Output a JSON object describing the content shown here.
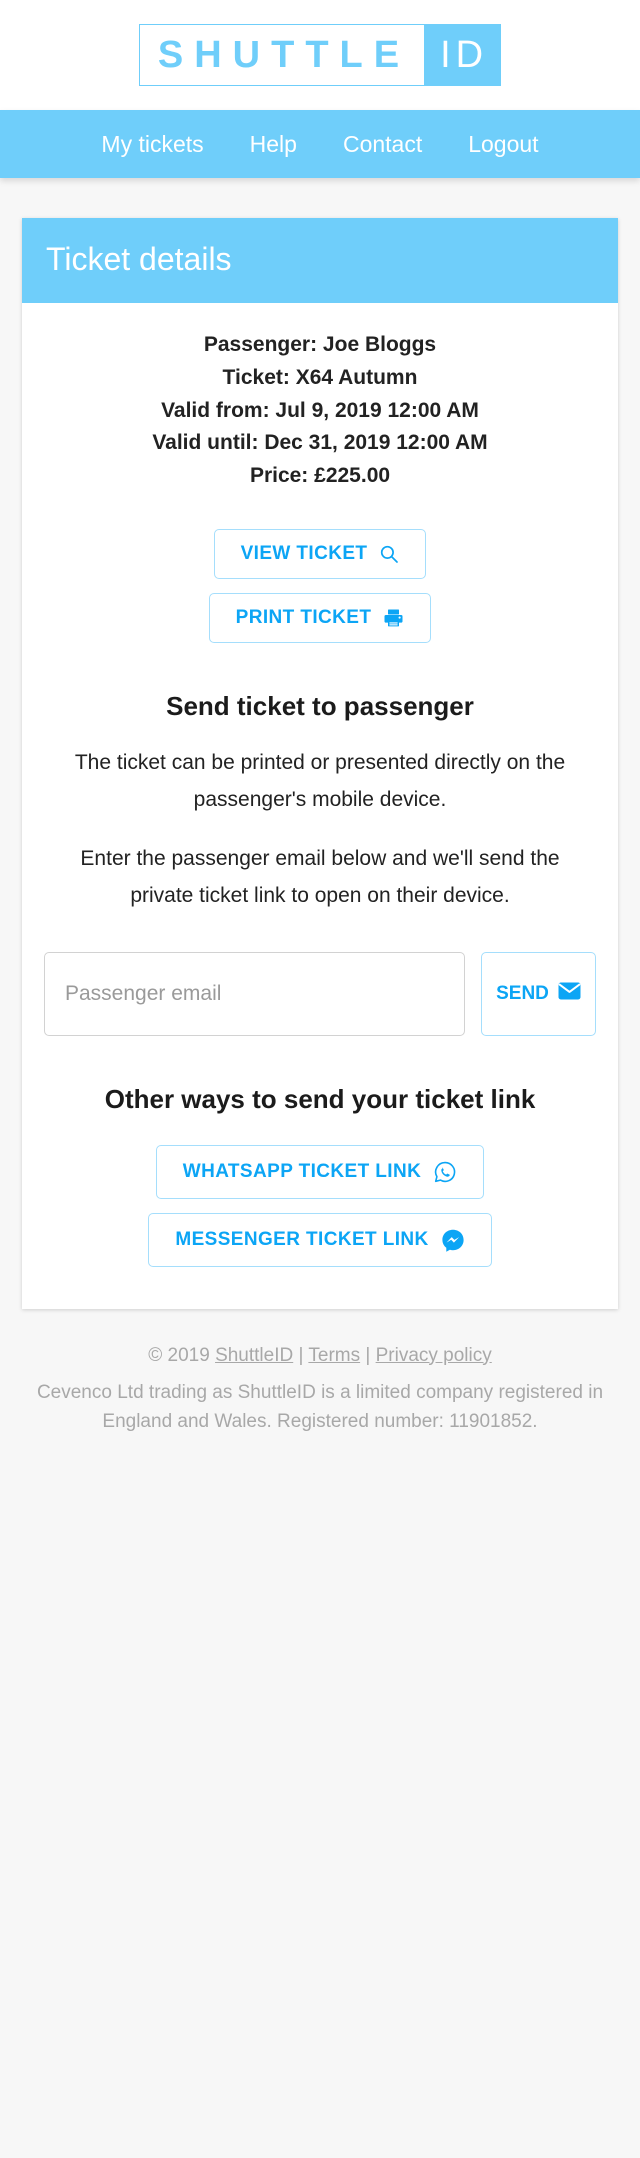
{
  "brand": {
    "logo_word": "SHUTTLE",
    "logo_suffix": "ID",
    "accent": "#6fcefa",
    "link_blue": "#0ca5f5"
  },
  "nav": {
    "items": [
      {
        "label": "My tickets"
      },
      {
        "label": "Help"
      },
      {
        "label": "Contact"
      },
      {
        "label": "Logout"
      }
    ]
  },
  "card": {
    "header_title": "Ticket details",
    "details": [
      "Passenger: Joe Bloggs",
      "Ticket: X64 Autumn",
      "Valid from: Jul 9, 2019 12:00 AM",
      "Valid until: Dec 31, 2019 12:00 AM",
      "Price: £225.00"
    ],
    "view_ticket_label": "VIEW TICKET",
    "print_ticket_label": "PRINT TICKET",
    "send_section_title": "Send ticket to passenger",
    "send_paragraph_1": "The ticket can be printed or presented directly on the passenger's mobile device.",
    "send_paragraph_2": "Enter the passenger email below and we'll send the private ticket link to open on their device.",
    "email_placeholder": "Passenger email",
    "email_value": "",
    "send_label": "SEND",
    "other_ways_title": "Other ways to send your ticket link",
    "whatsapp_label": "WHATSAPP TICKET LINK",
    "messenger_label": "MESSENGER TICKET LINK"
  },
  "footer": {
    "copyright_prefix": "© 2019 ",
    "brand_link": "ShuttleID",
    "sep1": " | ",
    "terms_link": "Terms",
    "sep2": " | ",
    "privacy_link": "Privacy policy",
    "legal": "Cevenco Ltd trading as ShuttleID is a limited company registered in England and Wales. Registered number: 11901852."
  },
  "icons": {
    "view": "search-icon",
    "print": "printer-icon",
    "send": "envelope-icon",
    "whatsapp": "whatsapp-icon",
    "messenger": "messenger-icon"
  }
}
